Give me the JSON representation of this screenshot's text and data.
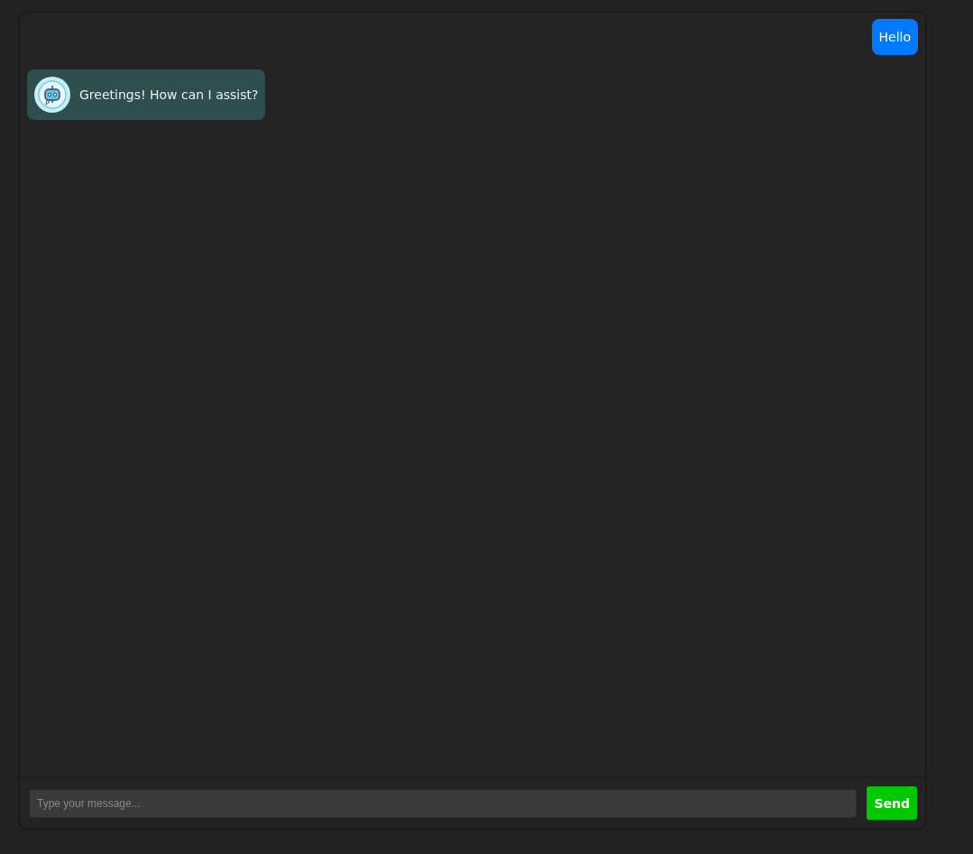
{
  "messages": [
    {
      "kind": "user",
      "text": "Hello"
    },
    {
      "kind": "bot",
      "text": "Greetings! How can I assist?"
    }
  ],
  "composer": {
    "placeholder": "Type your message...",
    "button": "Send"
  }
}
